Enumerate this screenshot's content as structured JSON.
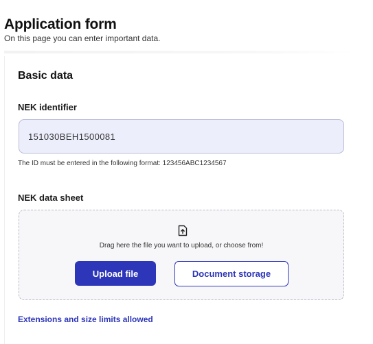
{
  "header": {
    "title": "Application form",
    "subtitle": "On this page you can enter important data."
  },
  "basic_data": {
    "section_title": "Basic data",
    "nek_identifier": {
      "label": "NEK identifier",
      "value": "151030BEH1500081",
      "hint": "The ID must be entered in the following format: 123456ABC1234567"
    },
    "nek_data_sheet": {
      "label": "NEK data sheet",
      "upload_icon": "file-upload-icon",
      "drop_text": "Drag here the file you want to upload, or choose from!",
      "upload_button": "Upload file",
      "storage_button": "Document storage"
    },
    "extensions_link": "Extensions and size limits allowed"
  },
  "colors": {
    "accent": "#2d36b8",
    "input_bg": "#eceefc",
    "dropzone_bg": "#f7f7f9"
  }
}
